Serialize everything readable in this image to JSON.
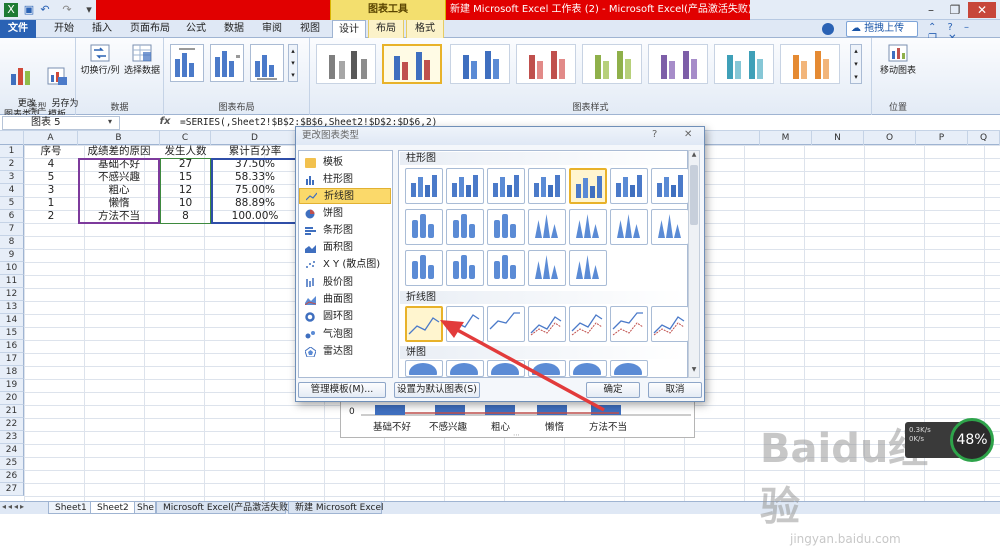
{
  "titlebar": {
    "chart_tools": "图表工具",
    "window_title": "新建 Microsoft Excel 工作表 (2) - Microsoft Excel(产品激活失败)"
  },
  "tabs": {
    "file": "文件",
    "items": [
      "开始",
      "插入",
      "页面布局",
      "公式",
      "数据",
      "审阅",
      "视图",
      "设计",
      "布局",
      "格式"
    ],
    "upload": "拖拽上传"
  },
  "ribbon": {
    "type_group": {
      "change_type": "更改\n图表类型",
      "save_template": "另存为\n模板",
      "label": "类型"
    },
    "data_group": {
      "switch": "切换行/列",
      "select": "选择数据",
      "label": "数据"
    },
    "layout_group": {
      "label": "图表布局"
    },
    "styles_group": {
      "label": "图表样式"
    },
    "position_group": {
      "move": "移动图表",
      "label": "位置"
    }
  },
  "formula_bar": {
    "name_box": "图表 5",
    "fx": "fx",
    "formula": "=SERIES(,Sheet2!$B$2:$B$6,Sheet2!$D$2:$D$6,2)"
  },
  "columns": [
    "A",
    "B",
    "C",
    "D",
    "",
    "",
    "",
    "",
    "",
    "",
    "M",
    "N",
    "O",
    "P",
    "Q",
    "R",
    "S",
    "T"
  ],
  "sheet": {
    "header": [
      "序号",
      "成绩差的原因",
      "发生人数",
      "累计百分率"
    ],
    "rows": [
      [
        "4",
        "基础不好",
        "27",
        "37.50%"
      ],
      [
        "5",
        "不感兴趣",
        "15",
        "58.33%"
      ],
      [
        "3",
        "粗心",
        "12",
        "75.00%"
      ],
      [
        "1",
        "懒惰",
        "10",
        "88.89%"
      ],
      [
        "2",
        "方法不当",
        "8",
        "100.00%"
      ]
    ]
  },
  "row_numbers": [
    "1",
    "2",
    "3",
    "4",
    "5",
    "6",
    "7",
    "8",
    "9",
    "10",
    "11",
    "12",
    "13",
    "14",
    "15",
    "16",
    "17",
    "18",
    "19",
    "20",
    "21",
    "22",
    "23",
    "24",
    "25",
    "26",
    "27"
  ],
  "chart_axis": {
    "zero": "0",
    "categories": [
      "基础不好",
      "不感兴趣",
      "粗心",
      "懒惰",
      "方法不当"
    ]
  },
  "dialog": {
    "title": "更改图表类型",
    "help": "?",
    "close": "✕",
    "categories": [
      "模板",
      "柱形图",
      "折线图",
      "饼图",
      "条形图",
      "面积图",
      "X Y (散点图)",
      "股价图",
      "曲面图",
      "圆环图",
      "气泡图",
      "雷达图"
    ],
    "selected_category": "折线图",
    "section_column": "柱形图",
    "section_line": "折线图",
    "section_pie": "饼图",
    "manage_templates": "管理模板(M)...",
    "set_default": "设置为默认图表(S)",
    "ok": "确定",
    "cancel": "取消"
  },
  "sheet_tabs": [
    "Sheet1",
    "Sheet2",
    "She",
    "Microsoft Excel(产品激活失败)",
    "新建 Microsoft Excel"
  ],
  "watermark": {
    "brand": "Baidu经验",
    "url": "jingyan.baidu.com"
  },
  "overlay": {
    "percent": "48%",
    "up": "0.3K/s",
    "down": "0K/s"
  },
  "colors": {
    "accent_selection": "#e8b22a",
    "file_tab": "#2a62b4",
    "window_bar": "#e10000",
    "arrow": "#e23b3b"
  }
}
